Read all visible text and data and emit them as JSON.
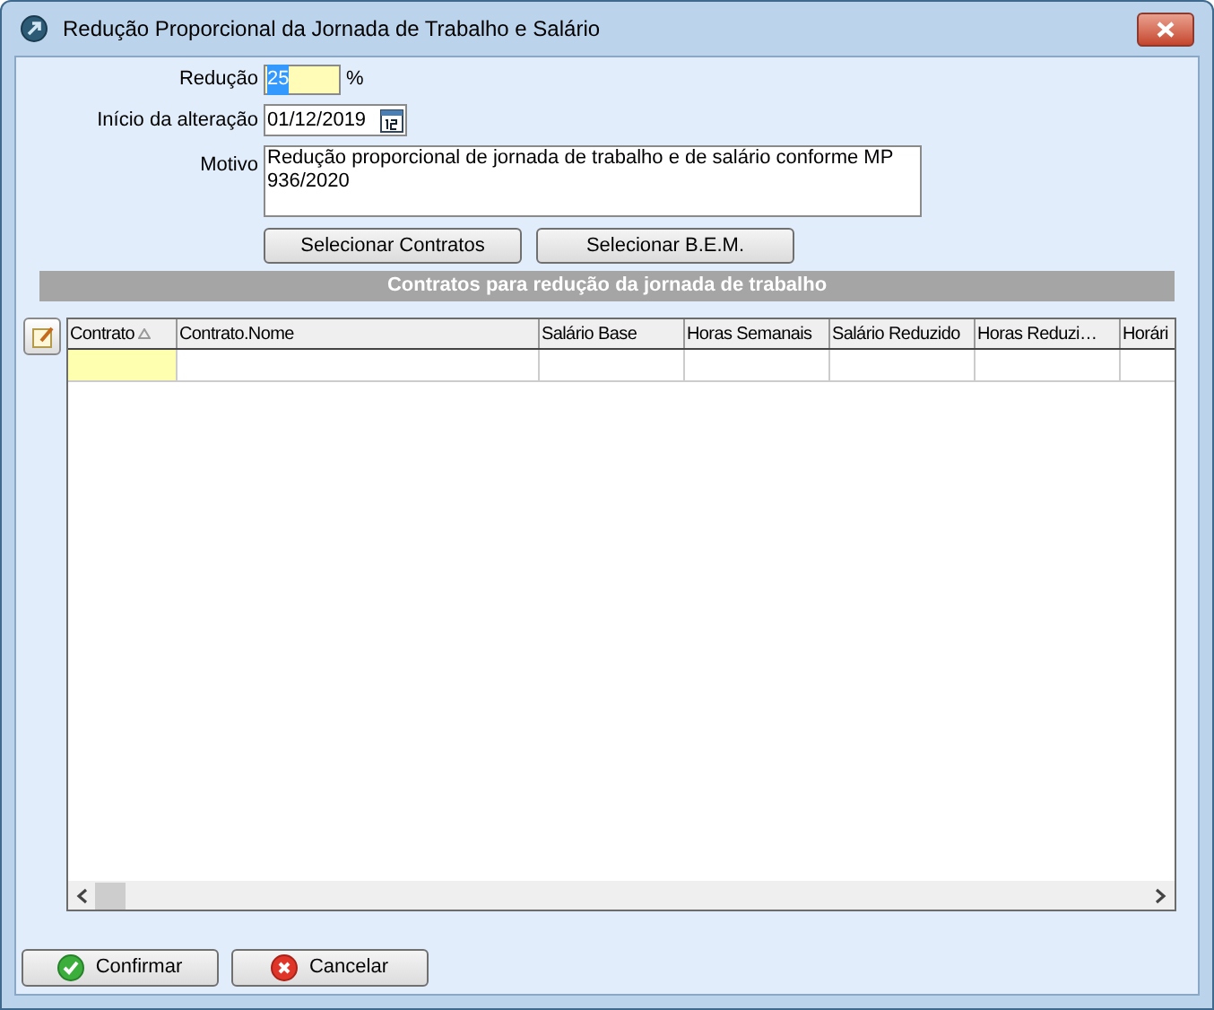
{
  "window": {
    "title": "Redução Proporcional da Jornada de Trabalho e Salário"
  },
  "form": {
    "reduction": {
      "label": "Redução",
      "value": "25",
      "text_selected": true,
      "unit": "%"
    },
    "start": {
      "label": "Início da alteração",
      "value": "01/12/2019"
    },
    "reason": {
      "label": "Motivo",
      "value": "Redução proporcional de jornada de trabalho e de salário conforme MP 936/2020"
    }
  },
  "select_buttons": [
    "Selecionar Contratos",
    "Selecionar B.E.M."
  ],
  "section_title": "Contratos para redução da jornada de trabalho",
  "grid": {
    "columns": [
      {
        "label": "Contrato",
        "sorted": true
      },
      {
        "label": "Contrato.Nome",
        "sorted": false
      },
      {
        "label": "Salário Base",
        "sorted": false
      },
      {
        "label": "Horas Semanais",
        "sorted": false
      },
      {
        "label": "Salário Reduzido",
        "sorted": false
      },
      {
        "label": "Horas Reduzi…",
        "sorted": false
      },
      {
        "label": "Horári",
        "sorted": false
      }
    ],
    "new_row": {
      "first_cell_highlighted": true
    }
  },
  "footer_buttons": [
    {
      "kind": "confirm",
      "label": "Confirmar"
    },
    {
      "kind": "cancel",
      "label": "Cancelar"
    }
  ]
}
